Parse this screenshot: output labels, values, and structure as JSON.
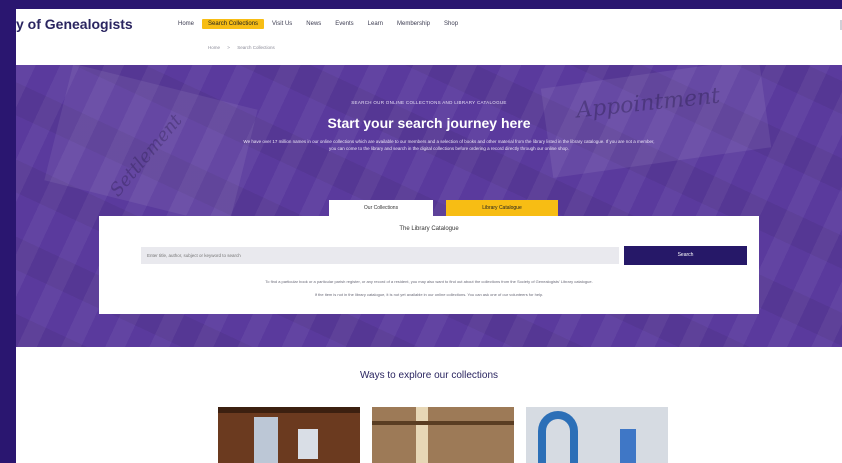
{
  "brand": {
    "name": "y of Genealogists"
  },
  "nav": {
    "items": [
      {
        "label": "Home",
        "active": false
      },
      {
        "label": "Search Collections",
        "active": true
      },
      {
        "label": "Visit Us",
        "active": false
      },
      {
        "label": "News",
        "active": false
      },
      {
        "label": "Events",
        "active": false
      },
      {
        "label": "Learn",
        "active": false
      },
      {
        "label": "Membership",
        "active": false
      },
      {
        "label": "Shop",
        "active": false
      }
    ]
  },
  "breadcrumb": {
    "items": [
      "Home",
      ">",
      "Search Collections"
    ]
  },
  "hero": {
    "eyebrow": "SEARCH OUR ONLINE COLLECTIONS AND LIBRARY CATALOGUE",
    "title": "Start your search journey here",
    "description": "We have over 17 million names in our online collections which are available to our members and a selection of books and other material from the library listed in the library catalogue. If you are not a member, you can come to the library and search in the digital collections before ordering a record directly through our online shop.",
    "script_1": "Appointment",
    "script_2": "Settlement"
  },
  "tabs": {
    "collections_label": "Our Collections",
    "catalogue_label": "Library Catalogue"
  },
  "catalogue_card": {
    "title": "The Library Catalogue",
    "search_placeholder": "Enter title, author, subject or keyword to search",
    "search_button": "Search",
    "note_1": "To find a particular book or a particular parish register, or any record of a resident, you may also want to find out about the collections from the Society of Genealogists' Library catalogue.",
    "note_2": "If the item is not in the library catalogue, it is not yet available in our online collections. You can ask one of our volunteers for help."
  },
  "explore": {
    "title": "Ways to explore our collections"
  },
  "colors": {
    "brand_purple": "#261868",
    "accent_yellow": "#f7bd14",
    "hero_purple": "#5a3a9d"
  }
}
